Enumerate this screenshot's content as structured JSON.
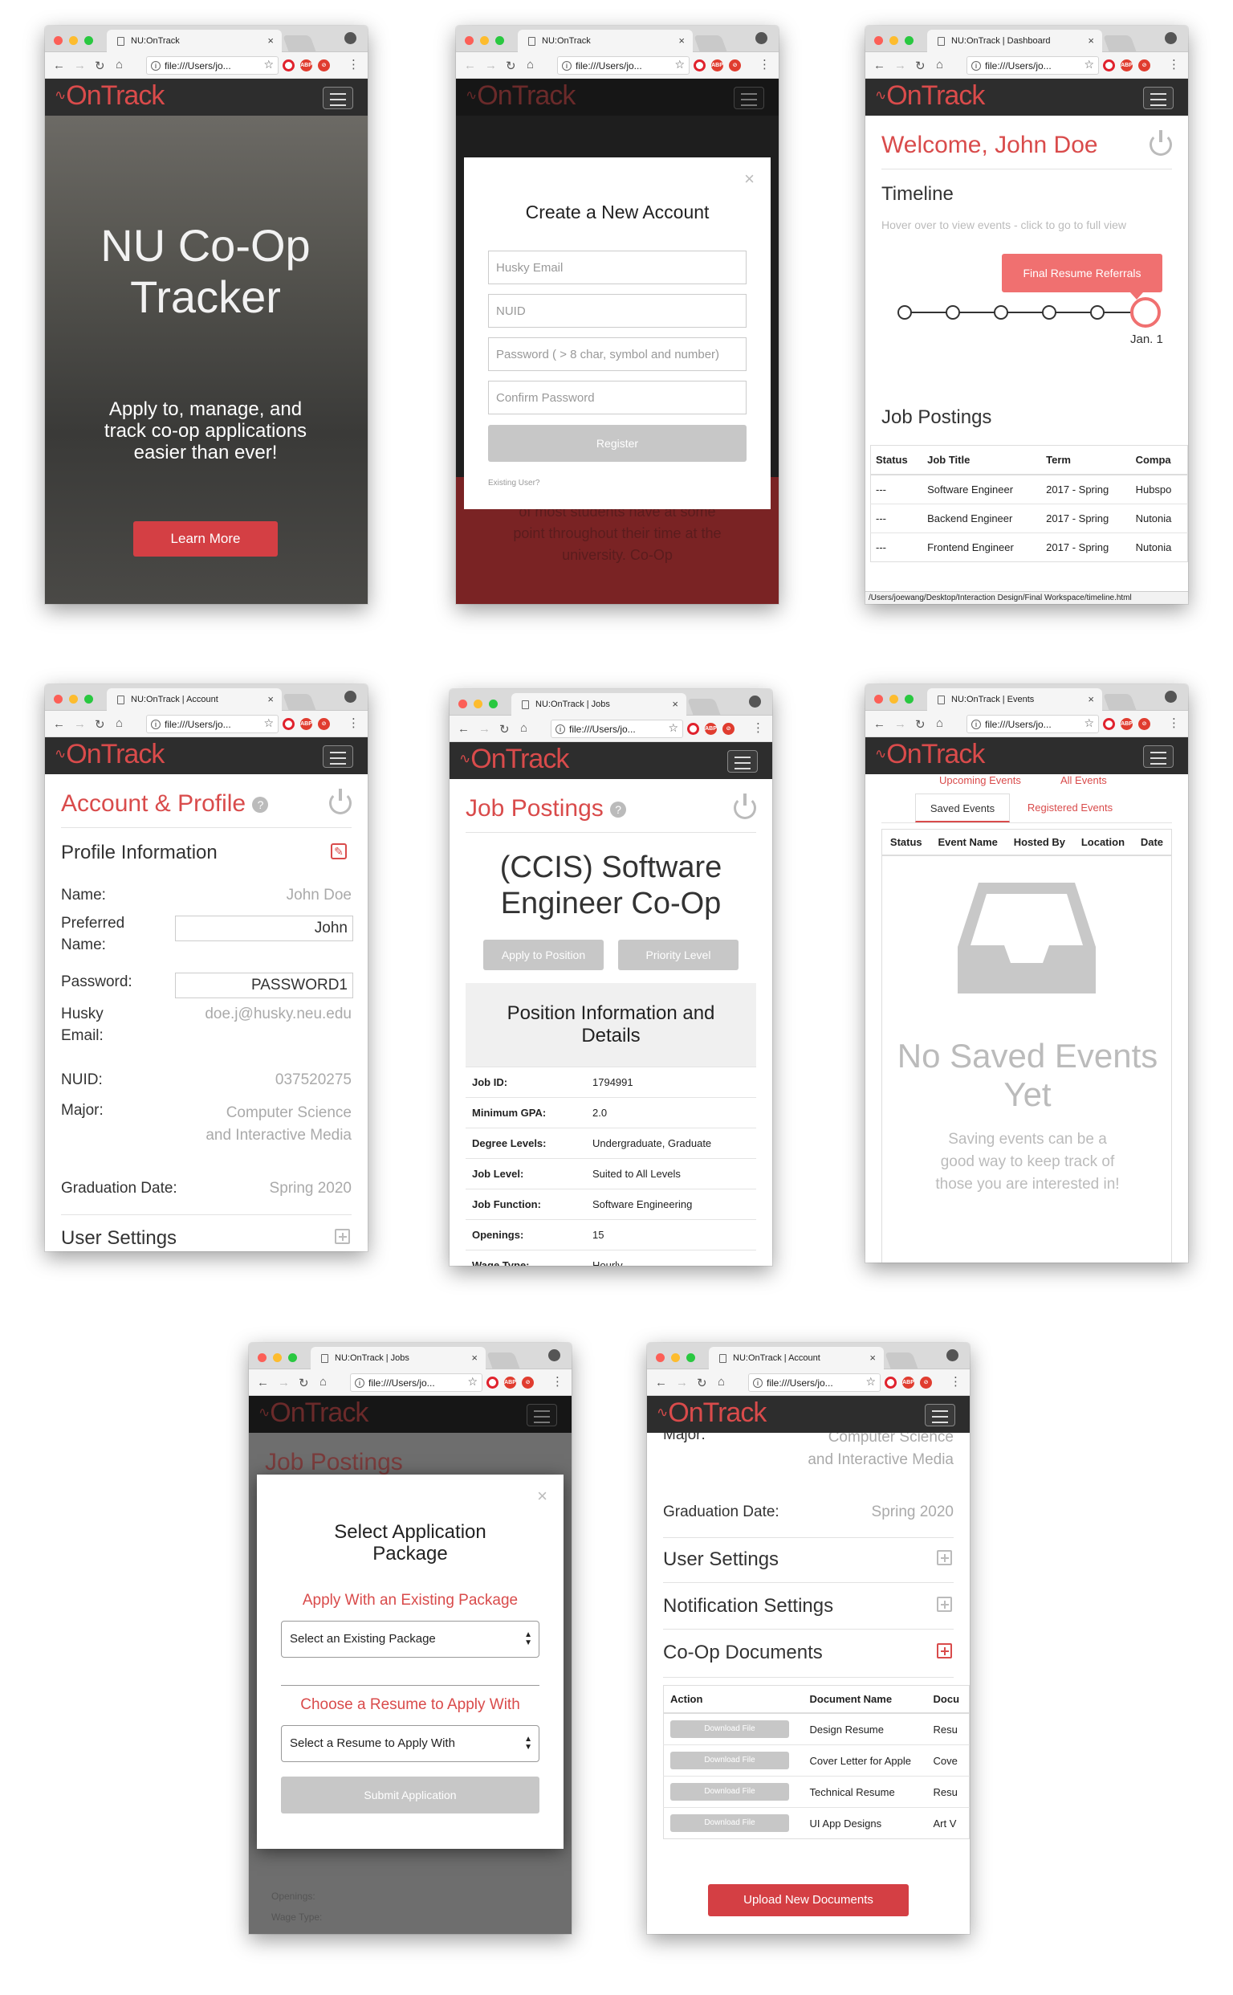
{
  "browser": {
    "address": "file:///Users/jo...",
    "abp_label": "ABP"
  },
  "logo_text": "OnTrack",
  "home": {
    "tab_title": "NU:OnTrack",
    "hero_title": "NU Co-Op Tracker",
    "hero_subtitle": "Apply to, manage, and track co-op applications easier than ever!",
    "cta": "Learn More"
  },
  "register": {
    "tab_title": "NU:OnTrack",
    "title": "Create a New Account",
    "email_placeholder": "Husky Email",
    "nuid_placeholder": "NUID",
    "password_placeholder": "Password ( > 8 char, symbol and number)",
    "confirm_placeholder": "Confirm Password",
    "register_button": "Register",
    "existing_user": "Existing User?",
    "bg_text": "of most students have at some point throughout their time at the university. Co-Op"
  },
  "dashboard": {
    "tab_title": "NU:OnTrack | Dashboard",
    "welcome": "Welcome, John Doe",
    "timeline_heading": "Timeline",
    "timeline_hint": "Hover over to view events - click to go to full view",
    "tooltip": "Final Resume Referrals",
    "timeline_date": "Jan. 1",
    "postings_heading": "Job Postings",
    "columns": [
      "Status",
      "Job Title",
      "Term",
      "Compa"
    ],
    "rows": [
      [
        "---",
        "Software Engineer",
        "2017 - Spring",
        "Hubspo"
      ],
      [
        "---",
        "Backend Engineer",
        "2017 - Spring",
        "Nutonia"
      ],
      [
        "---",
        "Frontend Engineer",
        "2017 - Spring",
        "Nutonia"
      ]
    ],
    "status_url": "/Users/joewang/Desktop/Interaction Design/Final Workspace/timeline.html"
  },
  "account": {
    "tab_title": "NU:OnTrack | Account",
    "title": "Account & Profile",
    "section": "Profile Information",
    "fields": [
      {
        "label": "Name:",
        "value": "John Doe"
      },
      {
        "label": "Preferred Name:",
        "value": "John"
      },
      {
        "label": "Password:",
        "value": "PASSWORD1"
      },
      {
        "label": "Husky Email:",
        "value": "doe.j@husky.neu.edu"
      },
      {
        "label": "NUID:",
        "value": "037520275"
      },
      {
        "label": "Major:",
        "value": "Computer Science and Interactive Media"
      },
      {
        "label": "Graduation Date:",
        "value": "Spring 2020"
      }
    ],
    "user_settings": "User Settings"
  },
  "job": {
    "tab_title": "NU:OnTrack | Jobs",
    "title": "Job Postings",
    "job_title": "(CCIS) Software Engineer Co-Op",
    "apply": "Apply to Position",
    "priority": "Priority Level",
    "details_heading": "Position Information and Details",
    "details": [
      [
        "Job ID:",
        "1794991"
      ],
      [
        "Minimum GPA:",
        "2.0"
      ],
      [
        "Degree Levels:",
        "Undergraduate, Graduate"
      ],
      [
        "Job Level:",
        "Suited to All Levels"
      ],
      [
        "Job Function:",
        "Software Engineering"
      ],
      [
        "Openings:",
        "15"
      ],
      [
        "Wage Type:",
        "Hourly"
      ]
    ]
  },
  "events": {
    "tab_title": "NU:OnTrack | Events",
    "upcoming": "Upcoming Events",
    "all": "All Events",
    "saved_tab": "Saved Events",
    "registered_tab": "Registered Events",
    "columns": [
      "Status",
      "Event Name",
      "Hosted By",
      "Location",
      "Date"
    ],
    "empty_title": "No Saved Events Yet",
    "empty_text": "Saving events can be a good way to keep track of those you are interested in!"
  },
  "apply_modal": {
    "tab_title": "NU:OnTrack | Jobs",
    "title": "Select Application Package",
    "existing_heading": "Apply With an Existing Package",
    "existing_select": "Select an Existing Package",
    "resume_heading": "Choose a Resume to Apply With",
    "resume_select": "Select a Resume to Apply With",
    "submit": "Submit Application",
    "bg_title": "Job Postings",
    "bg_rows": [
      "Openings:",
      "Wage Type:"
    ]
  },
  "account2": {
    "tab_title": "NU:OnTrack | Account",
    "major_label": "Major:",
    "major_value": "Computer Science and Interactive Media",
    "grad_label": "Graduation Date:",
    "grad_value": "Spring 2020",
    "user_settings": "User Settings",
    "notif_settings": "Notification Settings",
    "coop_docs": "Co-Op Documents",
    "columns": [
      "Action",
      "Document Name",
      "Docu"
    ],
    "download_label": "Download File",
    "docs": [
      [
        "Design Resume",
        "Resu"
      ],
      [
        "Cover Letter for Apple",
        "Cove"
      ],
      [
        "Technical Resume",
        "Resu"
      ],
      [
        "UI App Designs",
        "Art V"
      ]
    ],
    "upload": "Upload New Documents"
  },
  "colors": {
    "brand": "#d94b4b",
    "dark": "#2d2d2d"
  }
}
